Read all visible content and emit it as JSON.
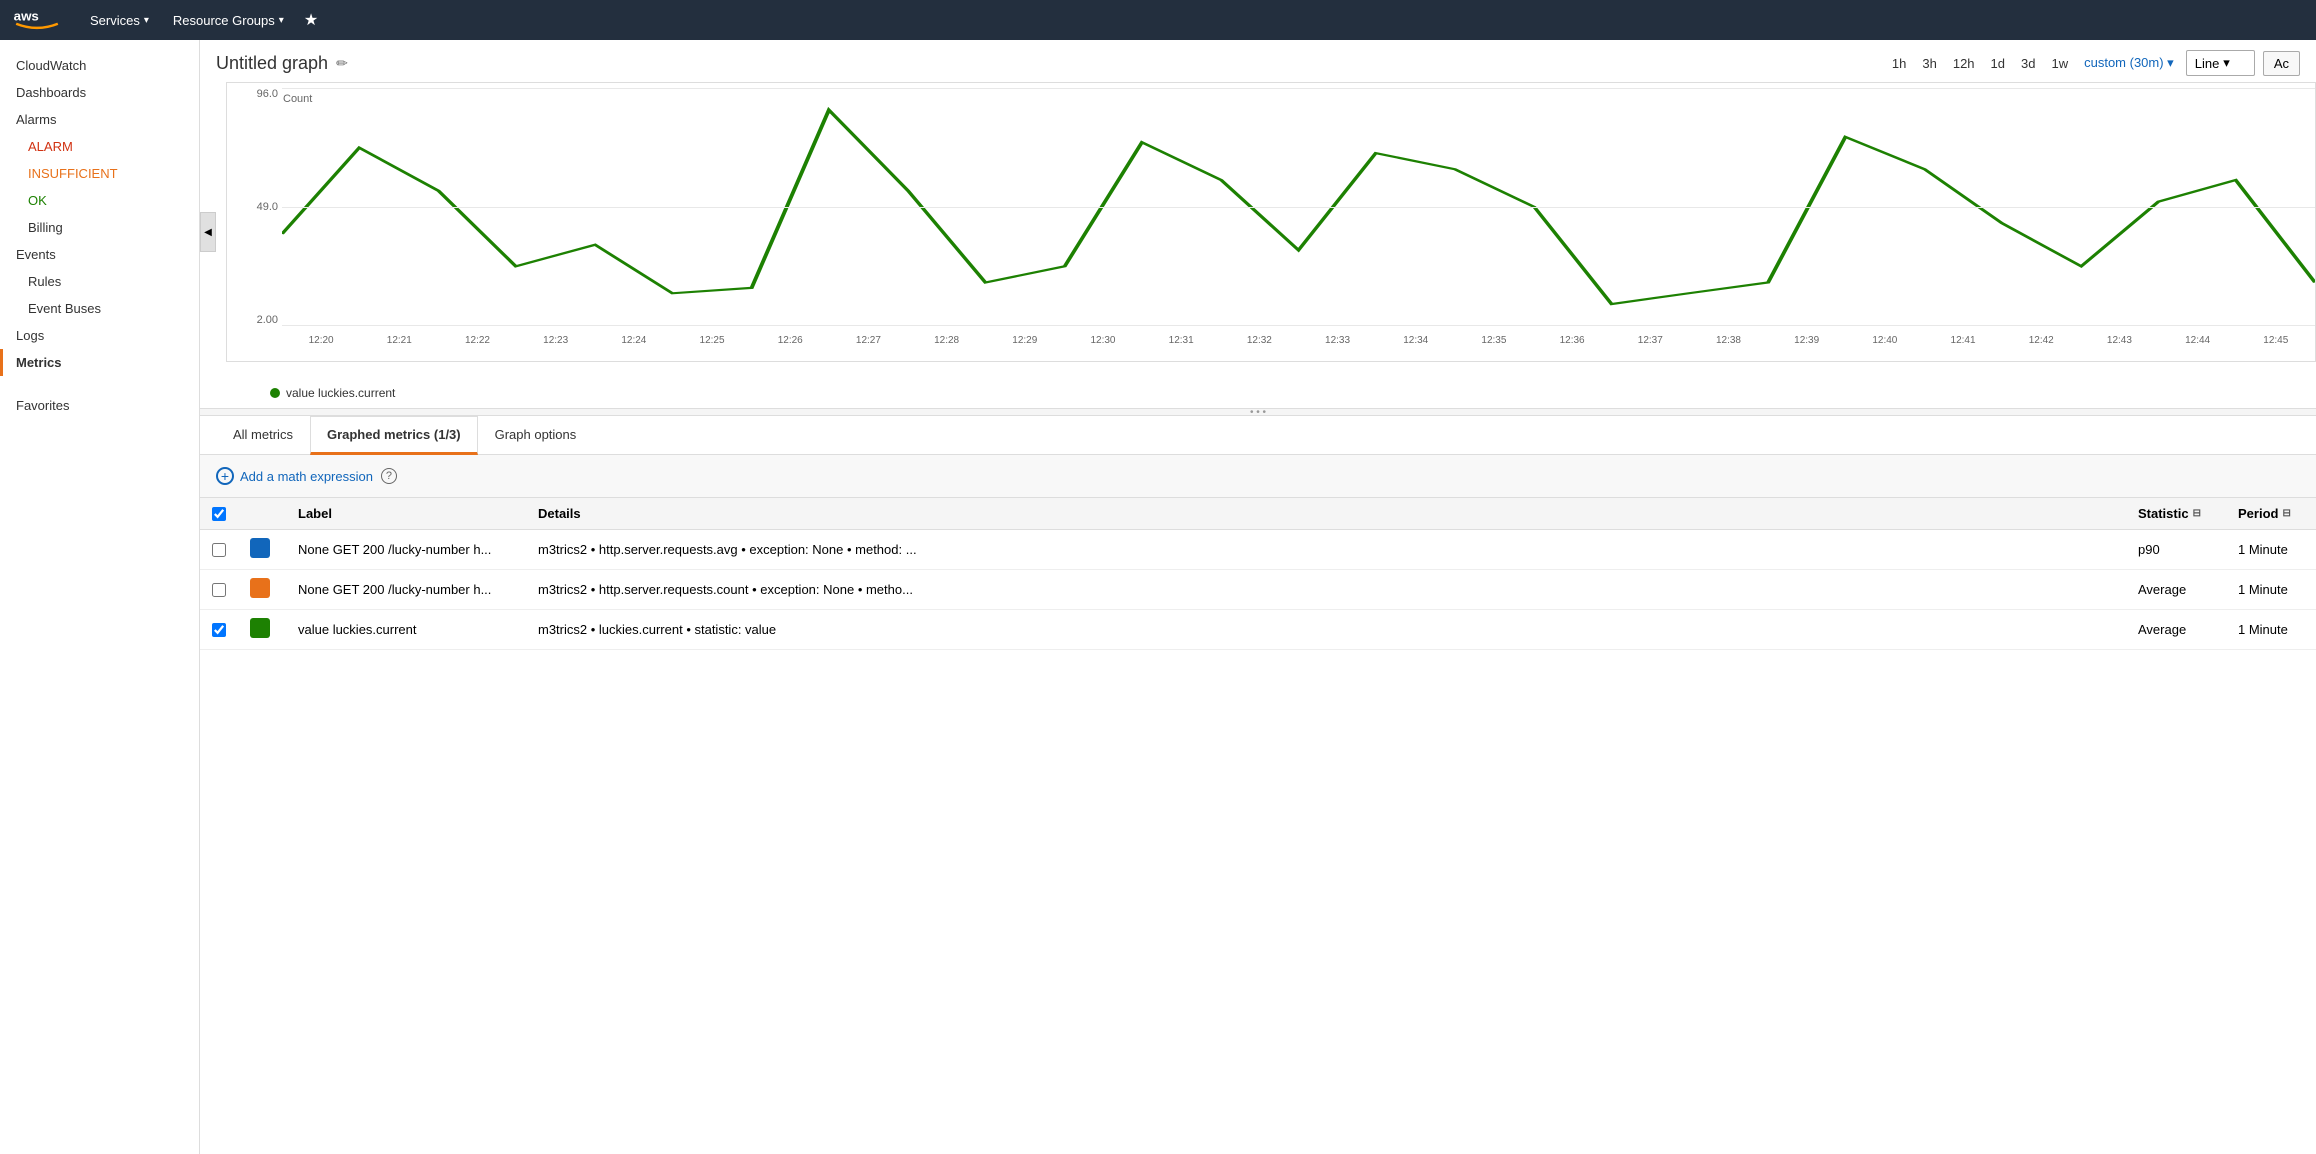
{
  "nav": {
    "services_label": "Services",
    "resource_groups_label": "Resource Groups",
    "services_chevron": "▾",
    "resource_groups_chevron": "▾"
  },
  "sidebar": {
    "cloudwatch": "CloudWatch",
    "dashboards": "Dashboards",
    "alarms": "Alarms",
    "alarm": "ALARM",
    "insufficient": "INSUFFICIENT",
    "ok": "OK",
    "billing": "Billing",
    "events": "Events",
    "rules": "Rules",
    "event_buses": "Event Buses",
    "logs": "Logs",
    "metrics": "Metrics",
    "favorites": "Favorites"
  },
  "graph": {
    "title": "Untitled graph",
    "edit_icon": "✏",
    "time_options": [
      "1h",
      "3h",
      "12h",
      "1d",
      "3d",
      "1w"
    ],
    "custom_time": "custom (30m)",
    "chart_type": "Line",
    "actions_label": "Ac",
    "y_axis_label": "Count",
    "y_values": [
      "96.0",
      "49.0",
      "2.00"
    ],
    "x_labels": [
      "12:20",
      "12:21",
      "12:22",
      "12:23",
      "12:24",
      "12:25",
      "12:26",
      "12:27",
      "12:28",
      "12:29",
      "12:30",
      "12:31",
      "12:32",
      "12:33",
      "12:34",
      "12:35",
      "12:36",
      "12:37",
      "12:38",
      "12:39",
      "12:40",
      "12:41",
      "12:42",
      "12:43",
      "12:44",
      "12:45"
    ],
    "legend_color": "#1d8102",
    "legend_label": "value luckies.current"
  },
  "tabs": {
    "all_metrics": "All metrics",
    "graphed_metrics": "Graphed metrics (1/3)",
    "graph_options": "Graph options"
  },
  "metrics_section": {
    "add_expression_label": "Add a math expression",
    "help": "?",
    "columns": {
      "label": "Label",
      "details": "Details",
      "statistic": "Statistic",
      "period": "Period"
    },
    "rows": [
      {
        "checked": false,
        "color": "#1166bb",
        "label": "None GET 200 /lucky-number h...",
        "details": "m3trics2 • http.server.requests.avg • exception: None • method: ...",
        "statistic": "p90",
        "period": "1 Minute"
      },
      {
        "checked": false,
        "color": "#e8711a",
        "label": "None GET 200 /lucky-number h...",
        "details": "m3trics2 • http.server.requests.count • exception: None • metho...",
        "statistic": "Average",
        "period": "1 Minute"
      },
      {
        "checked": true,
        "color": "#1d8102",
        "label": "value luckies.current",
        "details": "m3trics2 • luckies.current • statistic: value",
        "statistic": "Average",
        "period": "1 Minute"
      }
    ]
  },
  "resize_handle": "• • •"
}
